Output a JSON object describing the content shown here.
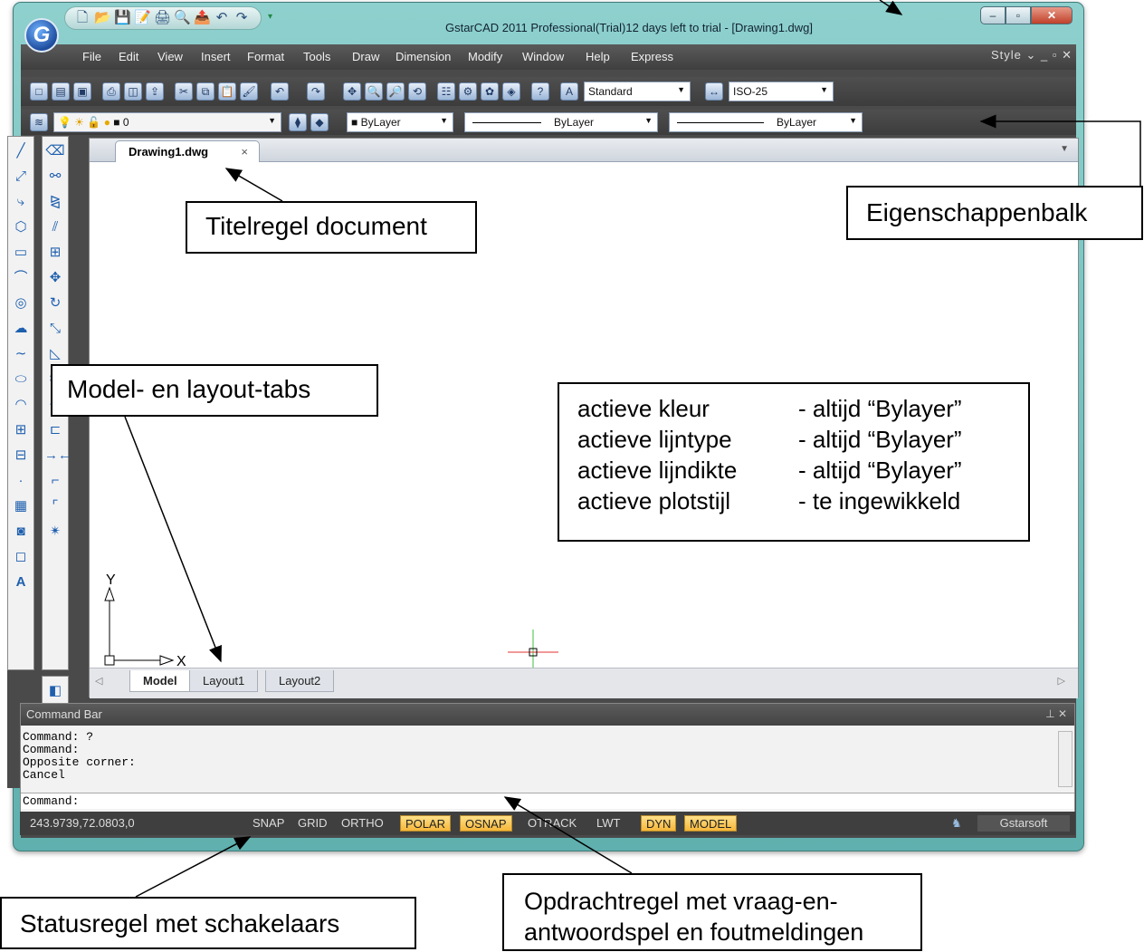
{
  "app": {
    "title": "GstarCAD 2011 Professional(Trial)12 days left to trial - [Drawing1.dwg]",
    "logo": "G"
  },
  "menu": {
    "items": [
      "File",
      "Edit",
      "View",
      "Insert",
      "Format",
      "Tools",
      "Draw",
      "Dimension",
      "Modify",
      "Window",
      "Help",
      "Express"
    ],
    "style_label": "Style ⌄ _ ▫ ✕"
  },
  "toolbar": {
    "text_style": "Standard",
    "dim_style": "ISO-25",
    "layer": "0",
    "color": "ByLayer",
    "linetype": "ByLayer",
    "lineweight": "ByLayer"
  },
  "document": {
    "tab_title": "Drawing1.dwg",
    "close": "×"
  },
  "layout_tabs": [
    "Model",
    "Layout1",
    "Layout2"
  ],
  "ucs": {
    "x_label": "X",
    "y_label": "Y"
  },
  "command_bar": {
    "title": "Command Bar",
    "history": [
      "Command: ?",
      "Command:",
      "Opposite corner:",
      "Cancel"
    ],
    "prompt": "Command:"
  },
  "status": {
    "coords": "243.9739,72.0803,0",
    "toggles": [
      {
        "label": "SNAP",
        "on": false
      },
      {
        "label": "GRID",
        "on": false
      },
      {
        "label": "ORTHO",
        "on": false
      },
      {
        "label": "POLAR",
        "on": true
      },
      {
        "label": "OSNAP",
        "on": true
      },
      {
        "label": "OTRACK",
        "on": false
      },
      {
        "label": "LWT",
        "on": false
      },
      {
        "label": "DYN",
        "on": true
      },
      {
        "label": "MODEL",
        "on": true
      }
    ],
    "brand": "Gstarsoft"
  },
  "callouts": {
    "titel_doc": "Titelregel document",
    "eigenschappen": "Eigenschappenbalk",
    "model_tabs": "Model- en layout-tabs",
    "status": "Statusregel met schakelaars",
    "opdracht": "Opdrachtregel met vraag-en-antwoordspel en foutmeldingen"
  },
  "info_box": {
    "rows": [
      {
        "left": "actieve kleur",
        "right": "- altijd “Bylayer”"
      },
      {
        "left": "actieve lijntype",
        "right": "- altijd “Bylayer”"
      },
      {
        "left": "actieve lijndikte",
        "right": "- altijd “Bylayer”"
      },
      {
        "left": "actieve plotstijl",
        "right": "- te ingewikkeld"
      }
    ]
  }
}
